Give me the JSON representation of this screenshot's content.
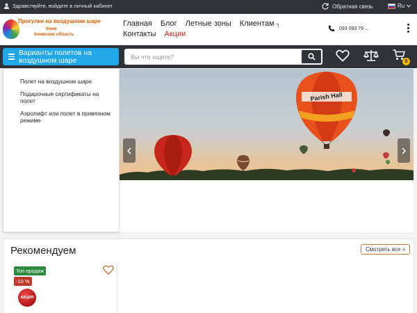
{
  "topbar": {
    "login_text": "Здравствуйте, войдите в личный кабинет",
    "feedback_label": "Обратная связь",
    "language": "Ru"
  },
  "header": {
    "logo": {
      "line1": "Прогулки на воздушном шаре",
      "line2": "Киев",
      "line3": "Киевская область"
    },
    "nav": {
      "row1": [
        "Главная",
        "Блог",
        "Летные зоны",
        "Клиентам"
      ],
      "row2": [
        "Контакты",
        "Акции"
      ]
    },
    "phone": "093 093 79 ..."
  },
  "searchbar": {
    "catalog_label": "Варианты полетов на воздушном шаре",
    "placeholder": "Вы что ищете?",
    "cart_count": "0"
  },
  "menu": {
    "items": [
      "Полет на воздушном шаре",
      "Подарочные сертификаты на полет",
      "Аэролифт или полет в привязном режиме"
    ]
  },
  "banner": {
    "balloon_text": "Parish Hall",
    "prev_icon": "chevron-left-icon",
    "next_icon": "chevron-right-icon"
  },
  "recommended": {
    "title": "Рекомендуем",
    "see_all": "Смотреть все »",
    "card": {
      "badge_top": "Топ продаж",
      "badge_sale": "-10 %",
      "thumb_text": "АКЦИЯ"
    }
  },
  "colors": {
    "dark_bar": "#2e3338",
    "catalog_blue": "#20a7e8",
    "accent_red": "#d0201a",
    "cart_badge": "#f5b400"
  }
}
